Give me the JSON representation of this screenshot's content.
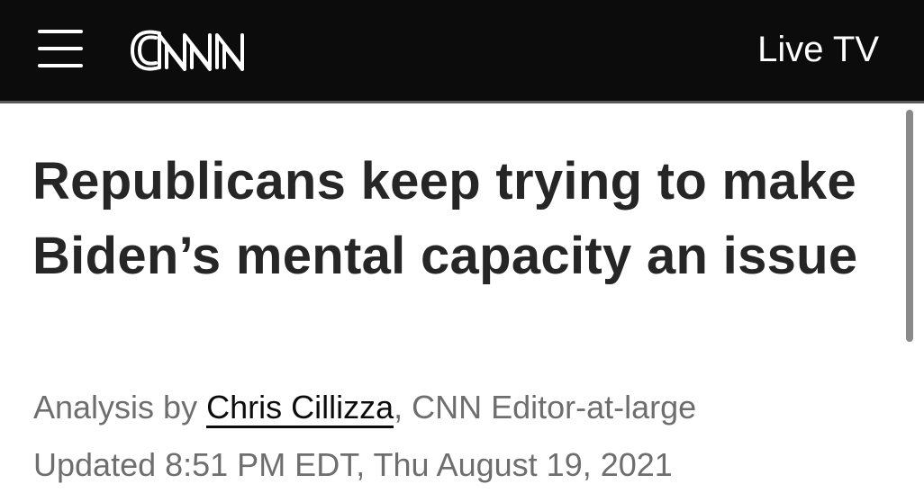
{
  "header": {
    "brand": "CNN",
    "live_tv_label": "Live TV"
  },
  "article": {
    "headline": "Republicans keep trying to make Biden’s mental capacity an issue",
    "byline": {
      "prefix": "Analysis by ",
      "author": "Chris Cillizza",
      "suffix": ", CNN Editor-at-large"
    },
    "updated": "Updated 8:51 PM EDT, Thu August 19, 2021"
  },
  "colors": {
    "header_bg": "#0c0c0c",
    "headline_text": "#262626",
    "meta_text": "#6e6e6e"
  },
  "icons": {
    "menu": "hamburger-menu-icon",
    "logo": "cnn-logo"
  }
}
